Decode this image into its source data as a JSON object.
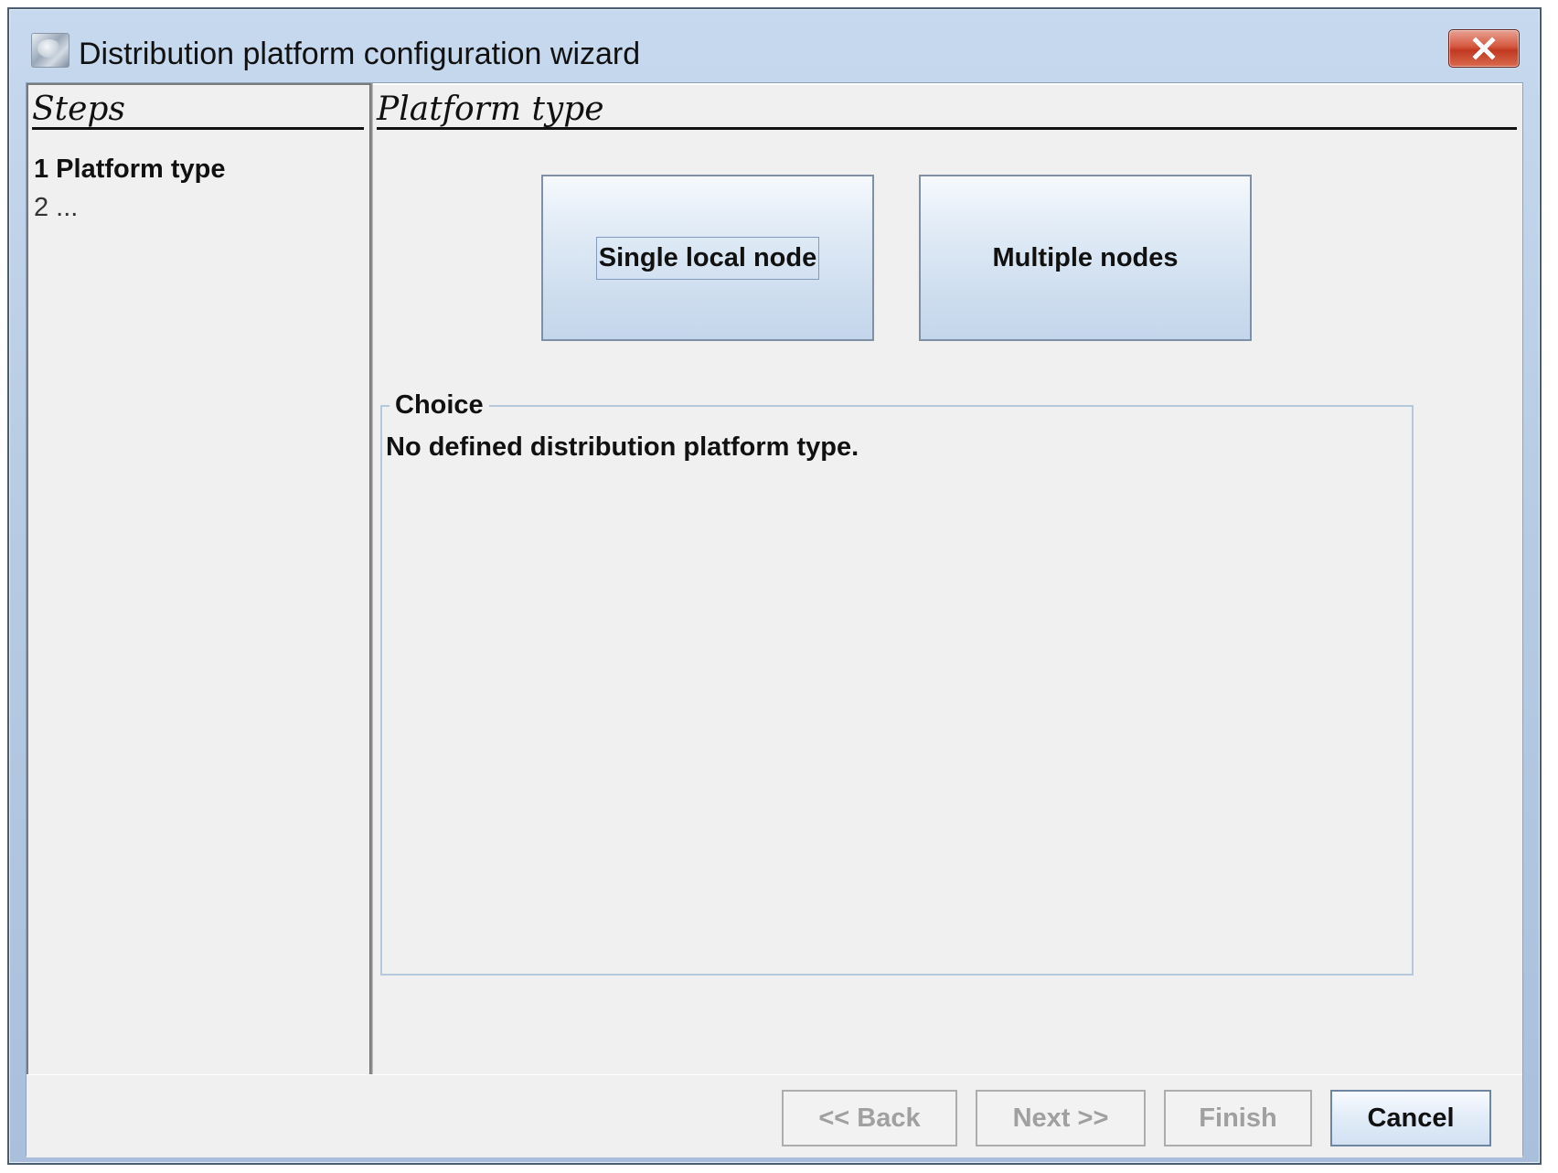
{
  "window": {
    "title": "Distribution platform configuration wizard",
    "icon": "app-icon",
    "close_icon": "close-icon"
  },
  "steps": {
    "header": "Steps",
    "items": [
      {
        "label": "1 Platform type",
        "state": "active"
      },
      {
        "label": "2 ...",
        "state": "pending"
      }
    ]
  },
  "content": {
    "header": "Platform type",
    "options": [
      {
        "label": "Single local node",
        "focused": true
      },
      {
        "label": "Multiple nodes",
        "focused": false
      }
    ],
    "choice": {
      "legend": "Choice",
      "text": "No defined distribution platform type."
    }
  },
  "buttons": {
    "back": {
      "label": "<< Back",
      "enabled": false
    },
    "next": {
      "label": "Next >>",
      "enabled": false
    },
    "finish": {
      "label": "Finish",
      "enabled": false
    },
    "cancel": {
      "label": "Cancel",
      "enabled": true
    }
  },
  "colors": {
    "close_button": "#c9452b",
    "title_gradient_top": "#c7d9ee",
    "panel_background": "#f0f0f0",
    "disabled_text": "#a0a0a0"
  }
}
